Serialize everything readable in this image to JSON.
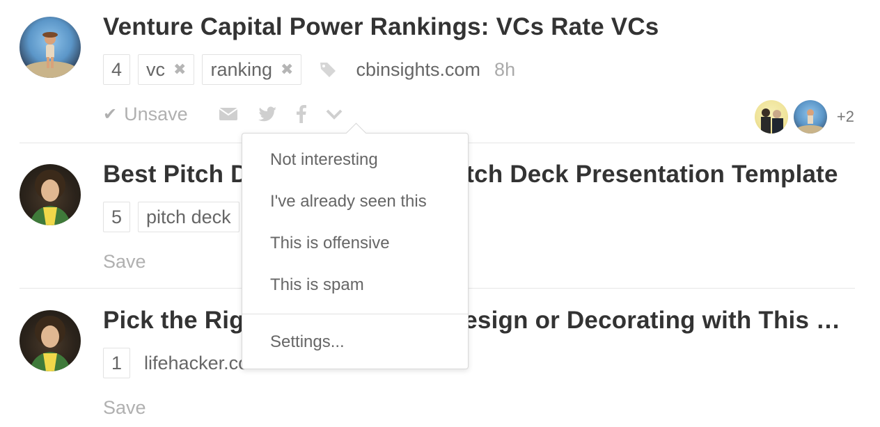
{
  "articles": [
    {
      "title": "Venture Capital Power Rankings: VCs Rate VCs",
      "count": "4",
      "tags": [
        "vc",
        "ranking"
      ],
      "source": "cbinsights.com",
      "time": "8h",
      "save_action": "Unsave",
      "savers_more": "+2"
    },
    {
      "title": "Best Pitch Deck Examples & Pitch Deck Presentation Template",
      "count": "5",
      "tags": [
        "pitch deck"
      ],
      "save_action": "Save"
    },
    {
      "title": "Pick the Right Color for Your Design or Decorating with This Co...",
      "count": "1",
      "source": "lifehacker.com",
      "save_action": "Save"
    }
  ],
  "dropdown": {
    "items": [
      "Not interesting",
      "I've already seen this",
      "This is offensive",
      "This is spam"
    ],
    "settings": "Settings..."
  },
  "icons": {
    "remove_tag": "close-icon",
    "tag": "tag-icon",
    "check": "check-icon",
    "email": "envelope-icon",
    "twitter": "twitter-icon",
    "facebook": "facebook-icon",
    "more": "chevron-down-icon"
  },
  "colors": {
    "title": "#333333",
    "muted": "#b0b0b0",
    "meta": "#666666"
  }
}
